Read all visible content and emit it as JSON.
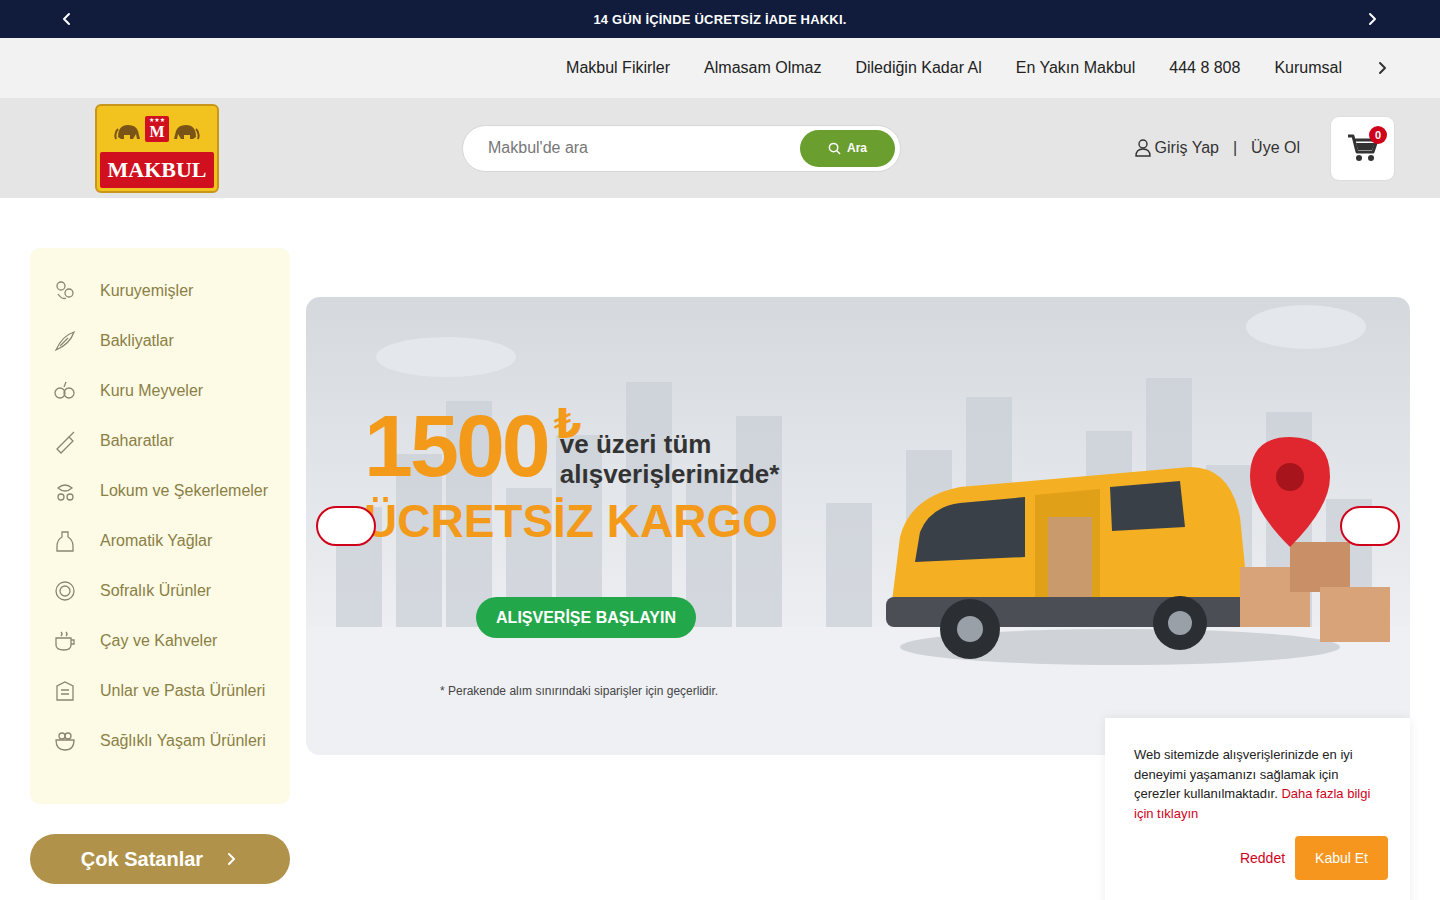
{
  "announcement": {
    "text": "14 GÜN İÇİNDE ÜCRETSİZ İADE HAKKI."
  },
  "top_nav": {
    "items": [
      "Makbul Fikirler",
      "Almasam Olmaz",
      "Dilediğin Kadar Al",
      "En Yakın Makbul",
      "444 8 808",
      "Kurumsal"
    ]
  },
  "header": {
    "logo": {
      "stars": "★★★",
      "letter": "M",
      "wordmark": "MAKBUL"
    },
    "search": {
      "placeholder": "Makbul'de ara",
      "button": "Ara"
    },
    "account": {
      "login": "Giriş Yap",
      "separator": "|",
      "register": "Üye Ol"
    },
    "cart": {
      "count": "0"
    }
  },
  "categories": [
    "Kuruyemişler",
    "Bakliyatlar",
    "Kuru Meyveler",
    "Baharatlar",
    "Lokum ve Şekerlemeler",
    "Aromatik Yağlar",
    "Sofralık Ürünler",
    "Çay ve Kahveler",
    "Unlar ve Pasta Ürünleri",
    "Sağlıklı Yaşam Ürünleri"
  ],
  "best_sellers": "Çok Satanlar",
  "banner": {
    "amount": "1500",
    "currency": "₺",
    "line1": "ve üzeri tüm",
    "line2": "alışverişlerinizde*",
    "headline": "ÜCRETSİZ KARGO",
    "cta": "ALIŞVERİŞE BAŞLAYIN",
    "note": "* Perakende alım sınırındaki siparişler için geçerlidir."
  },
  "cookie": {
    "text": "Web sitemizde alışverişlerinizde en iyi deneyimi yaşamanızı sağlamak için çerezler kullanılmaktadır.",
    "link": "Daha fazla bilgi için tıklayın",
    "reject": "Reddet",
    "accept": "Kabul Et"
  }
}
